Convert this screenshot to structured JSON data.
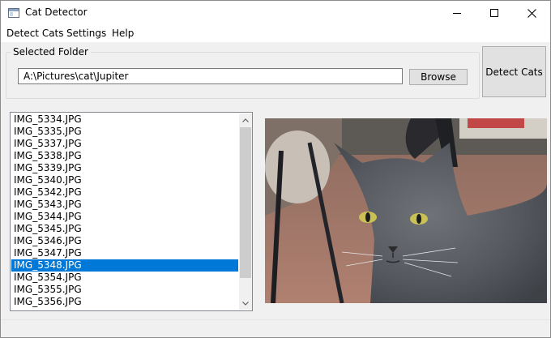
{
  "window": {
    "title": "Cat Detector"
  },
  "menu": [
    {
      "label": "Detect Cats"
    },
    {
      "label": "Settings"
    },
    {
      "label": "Help"
    }
  ],
  "folder": {
    "group_label": "Selected Folder",
    "path": "A:\\Pictures\\cat\\Jupiter",
    "browse_label": "Browse"
  },
  "detect_button_label": "Detect Cats",
  "files": {
    "items": [
      "IMG_5334.JPG",
      "IMG_5335.JPG",
      "IMG_5337.JPG",
      "IMG_5338.JPG",
      "IMG_5339.JPG",
      "IMG_5340.JPG",
      "IMG_5342.JPG",
      "IMG_5343.JPG",
      "IMG_5344.JPG",
      "IMG_5345.JPG",
      "IMG_5346.JPG",
      "IMG_5347.JPG",
      "IMG_5348.JPG",
      "IMG_5354.JPG",
      "IMG_5355.JPG",
      "IMG_5356.JPG"
    ],
    "selected_index": 12
  },
  "preview": {
    "description": "photo-of-gray-cat"
  },
  "colors": {
    "selection": "#0078d7",
    "window_bg": "#f0f0f0"
  },
  "icons": [
    "app-icon",
    "minimize-icon",
    "maximize-icon",
    "close-icon",
    "scroll-up-icon",
    "scroll-down-icon"
  ]
}
